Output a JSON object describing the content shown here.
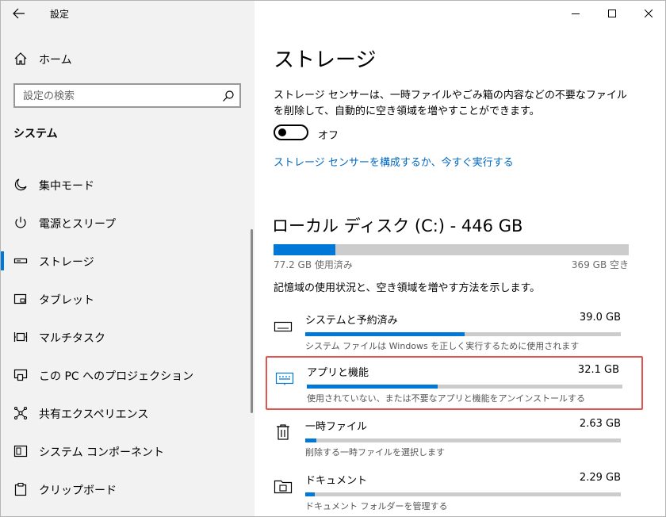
{
  "window": {
    "title": "設定"
  },
  "sidebar": {
    "home_label": "ホーム",
    "search_placeholder": "設定の検索",
    "section_title": "システム",
    "items": [
      {
        "label": "集中モード",
        "icon": "moon-icon"
      },
      {
        "label": "電源とスリープ",
        "icon": "power-icon"
      },
      {
        "label": "ストレージ",
        "icon": "storage-drive-icon",
        "active": true
      },
      {
        "label": "タブレット",
        "icon": "tablet-icon"
      },
      {
        "label": "マルチタスク",
        "icon": "multitask-icon"
      },
      {
        "label": "この PC へのプロジェクション",
        "icon": "projection-icon"
      },
      {
        "label": "共有エクスペリエンス",
        "icon": "share-icon"
      },
      {
        "label": "システム コンポーネント",
        "icon": "components-icon"
      },
      {
        "label": "クリップボード",
        "icon": "clipboard-icon"
      }
    ]
  },
  "main": {
    "title": "ストレージ",
    "description": "ストレージ センサーは、一時ファイルやごみ箱の内容などの不要なファイルを削除して、自動的に空き領域を増やすことができます。",
    "toggle_state": "オフ",
    "configure_link": "ストレージ センサーを構成するか、今すぐ実行する",
    "disk": {
      "title": "ローカル ディスク (C:) - 446 GB",
      "used_label": "77.2 GB 使用済み",
      "free_label": "369 GB 空き",
      "used_fraction": 0.173
    },
    "usage_info": "記憶域の使用状況と、空き領域を増やす方法を示します。",
    "categories": [
      {
        "name": "システムと予約済み",
        "size": "39.0 GB",
        "desc": "システム ファイルは Windows を正しく実行するために使用されます",
        "fraction": 0.505,
        "icon": "keyboard-icon"
      },
      {
        "name": "アプリと機能",
        "size": "32.1 GB",
        "desc": "使用されていない、または不要なアプリと機能をアンインストールする",
        "fraction": 0.415,
        "icon": "monitor-keyboard-icon",
        "highlighted": true
      },
      {
        "name": "一時ファイル",
        "size": "2.63 GB",
        "desc": "削除する一時ファイルを選択します",
        "fraction": 0.035,
        "icon": "trash-icon"
      },
      {
        "name": "ドキュメント",
        "size": "2.29 GB",
        "desc": "ドキュメント フォルダーを管理する",
        "fraction": 0.03,
        "icon": "folder-icon"
      }
    ]
  },
  "colors": {
    "accent": "#0078d7",
    "link": "#0067c0",
    "highlight": "#e2534f"
  }
}
